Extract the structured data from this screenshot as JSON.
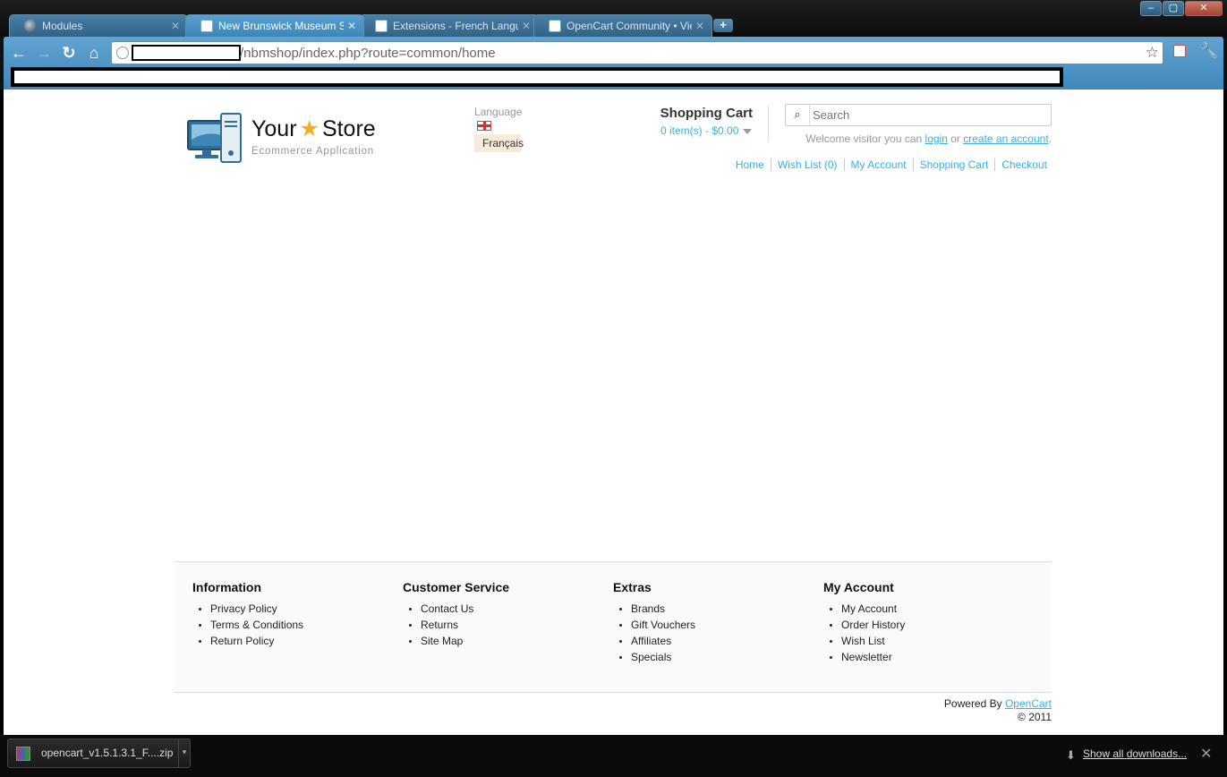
{
  "browser": {
    "tabs": [
      {
        "title": "Modules",
        "icon": "globe-icon",
        "active": false
      },
      {
        "title": "New Brunswick Museum Sh",
        "icon": "shopping-cart-icon",
        "active": true
      },
      {
        "title": "Extensions - French Langua",
        "icon": "opencart-icon",
        "active": false
      },
      {
        "title": "OpenCart Community • Vie",
        "icon": "opencart-icon",
        "active": false
      }
    ],
    "new_tab_label": "+",
    "window_controls": {
      "minimize": "–",
      "maximize": "▢",
      "close": "✕"
    },
    "url_path": "/nbmshop/index.php?route=common/home",
    "download": {
      "filename": "opencart_v1.5.1.3.1_F....zip"
    },
    "show_all_downloads": "Show all downloads..."
  },
  "store": {
    "logo": {
      "title_left": "Your",
      "title_right": "Store",
      "tagline": "Ecommerce Application"
    },
    "language": {
      "label": "Language",
      "option": "Français"
    },
    "cart": {
      "heading": "Shopping Cart",
      "total": "0 item(s) - $0.00"
    },
    "search": {
      "placeholder": "Search"
    },
    "welcome": {
      "prefix": "Welcome visitor you can",
      "login": "login",
      "or": "or",
      "create_account": "create an account",
      "suffix": "."
    },
    "top_links": [
      "Home",
      "Wish List (0)",
      "My Account",
      "Shopping Cart",
      "Checkout"
    ]
  },
  "footer": {
    "columns": [
      {
        "heading": "Information",
        "items": [
          "Privacy Policy",
          "Terms & Conditions",
          "Return Policy"
        ]
      },
      {
        "heading": "Customer Service",
        "items": [
          "Contact Us",
          "Returns",
          "Site Map"
        ]
      },
      {
        "heading": "Extras",
        "items": [
          "Brands",
          "Gift Vouchers",
          "Affiliates",
          "Specials"
        ]
      },
      {
        "heading": "My Account",
        "items": [
          "My Account",
          "Order History",
          "Wish List",
          "Newsletter"
        ]
      }
    ],
    "powered_by": "Powered By",
    "powered_link": "OpenCart",
    "copyright": "© 2011"
  }
}
